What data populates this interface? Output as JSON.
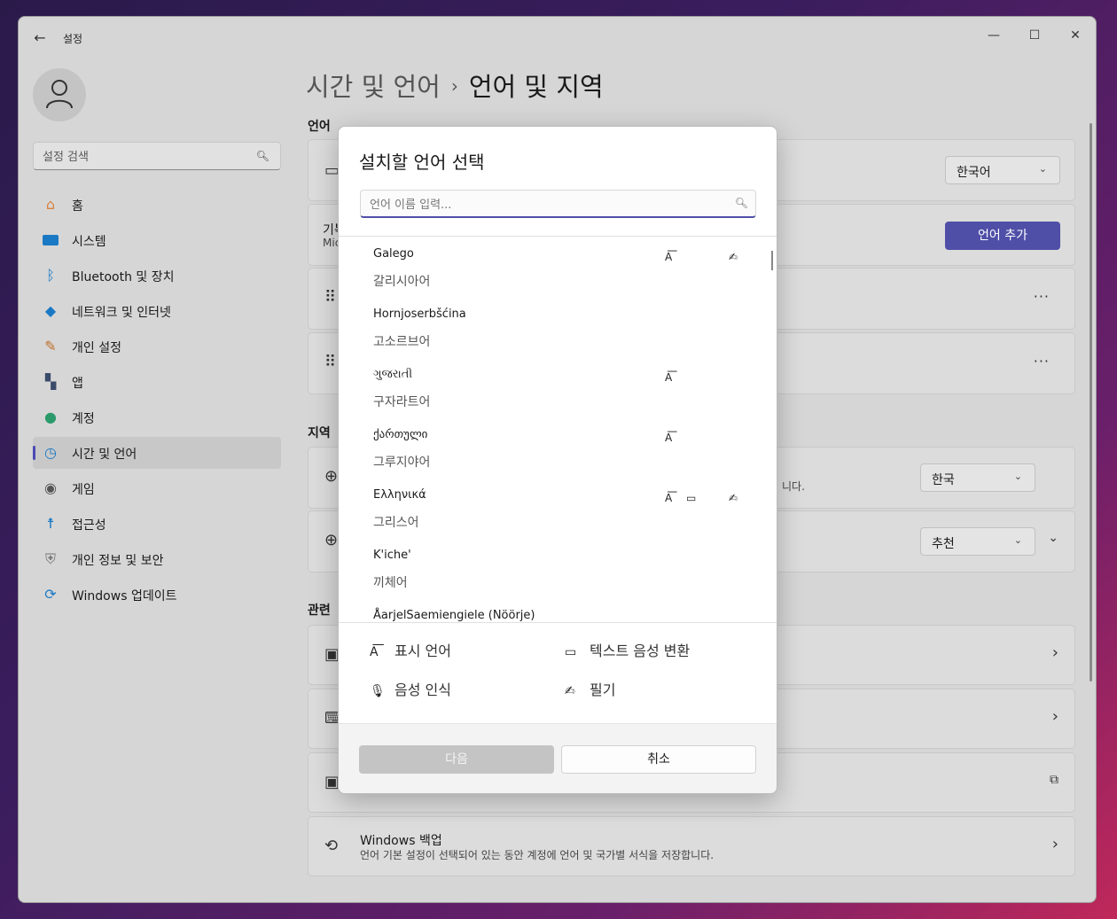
{
  "titlebar": {
    "back": "←",
    "app_title": "설정",
    "minimize": "—",
    "maximize": "☐",
    "close": "✕"
  },
  "sidebar": {
    "search_placeholder": "설정 검색",
    "items": [
      {
        "label": "홈",
        "icon": "home-icon"
      },
      {
        "label": "시스템",
        "icon": "system-icon"
      },
      {
        "label": "Bluetooth 및 장치",
        "icon": "bluetooth-icon"
      },
      {
        "label": "네트워크 및 인터넷",
        "icon": "wifi-icon"
      },
      {
        "label": "개인 설정",
        "icon": "brush-icon"
      },
      {
        "label": "앱",
        "icon": "apps-icon"
      },
      {
        "label": "계정",
        "icon": "account-icon"
      },
      {
        "label": "시간 및 언어",
        "icon": "time-language-icon",
        "active": true
      },
      {
        "label": "게임",
        "icon": "gaming-icon"
      },
      {
        "label": "접근성",
        "icon": "accessibility-icon"
      },
      {
        "label": "개인 정보 및 보안",
        "icon": "shield-icon"
      },
      {
        "label": "Windows 업데이트",
        "icon": "update-icon"
      }
    ]
  },
  "main": {
    "breadcrumb_parent": "시간 및 언어",
    "breadcrumb_sep": "›",
    "breadcrumb_current": "언어 및 지역",
    "section_language": "언어",
    "display_language_value": "한국어",
    "preferred_title_partial": "기븏",
    "preferred_desc_partial": "Mic",
    "add_language_button": "언어 추가",
    "section_region": "지역",
    "region_desc_partial": "니다.",
    "country_value": "한국",
    "format_value": "추천",
    "section_related": "관련",
    "backup_title": "Windows 백업",
    "backup_desc": "언어 기본 설정이 선택되어 있는 동안 계정에 언어 및 국가별 서식을 저장합니다."
  },
  "dialog": {
    "title": "설치할 언어 선택",
    "search_placeholder": "언어 이름 입력...",
    "languages": [
      {
        "native": "Galego",
        "korean": "갈리시아어",
        "display": true,
        "tts": false,
        "handwriting": true
      },
      {
        "native": "Hornjoserbšćina",
        "korean": "고소르브어",
        "display": false,
        "tts": false,
        "handwriting": false
      },
      {
        "native": "ગુજરાતી",
        "korean": "구자라트어",
        "display": true,
        "tts": false,
        "handwriting": false
      },
      {
        "native": "ქართული",
        "korean": "그루지야어",
        "display": true,
        "tts": false,
        "handwriting": false
      },
      {
        "native": "Ελληνικά",
        "korean": "그리스어",
        "display": true,
        "tts": true,
        "handwriting": true
      },
      {
        "native": "K'iche'",
        "korean": "끼체어",
        "display": false,
        "tts": false,
        "handwriting": false
      },
      {
        "native": "ÅarjelSaemiengiele (Nöörje)",
        "korean": "",
        "display": false,
        "tts": false,
        "handwriting": false
      }
    ],
    "legend": {
      "display_language": "표시 언어",
      "tts": "텍스트 음성 변환",
      "speech": "음성 인식",
      "handwriting": "필기"
    },
    "next_button": "다음",
    "cancel_button": "취소"
  },
  "colors": {
    "accent": "#4f4fa8",
    "window_bg": "#d6d6d6",
    "dialog_bg": "#ffffff"
  }
}
